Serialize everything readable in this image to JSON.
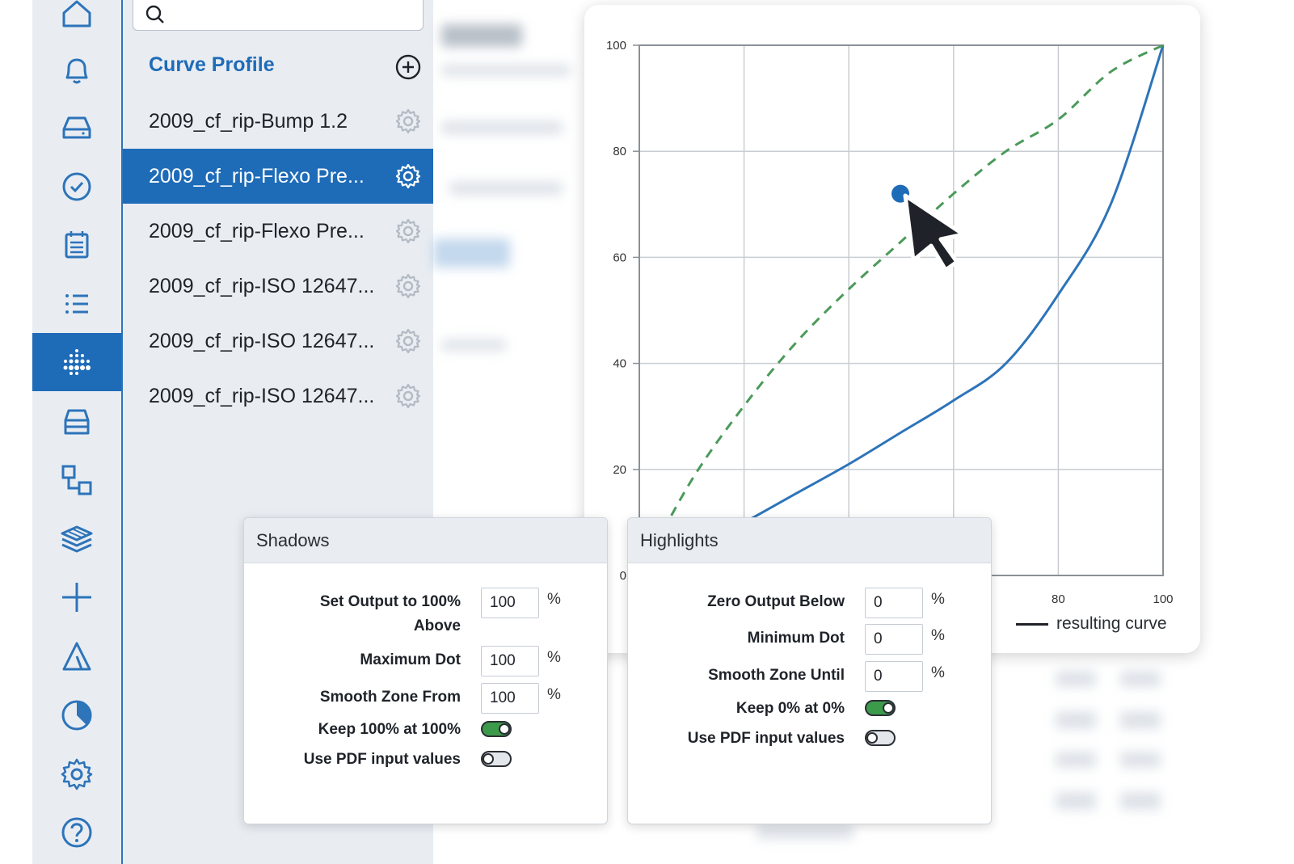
{
  "search": {
    "placeholder": ""
  },
  "panel": {
    "title": "Curve Profile",
    "profiles": [
      {
        "label": "2009_cf_rip-Bump 1.2",
        "selected": false
      },
      {
        "label": "2009_cf_rip-Flexo Pre...",
        "selected": true
      },
      {
        "label": "2009_cf_rip-Flexo Pre...",
        "selected": false
      },
      {
        "label": "2009_cf_rip-ISO 12647...",
        "selected": false
      },
      {
        "label": "2009_cf_rip-ISO 12647...",
        "selected": false
      },
      {
        "label": "2009_cf_rip-ISO 12647...",
        "selected": false
      }
    ]
  },
  "rail": {
    "icons": [
      "home-icon",
      "bell-icon",
      "drive-icon",
      "check-circle-icon",
      "calendar-icon",
      "list-icon",
      "dot-grid-icon",
      "tray-icon",
      "nodes-icon",
      "layers-icon",
      "crop-icon",
      "triangle-icon",
      "pie-icon",
      "gear-icon",
      "help-icon"
    ],
    "active_index": 6
  },
  "chart_data": {
    "type": "line",
    "x_ticks": [
      80,
      100
    ],
    "y_ticks": [
      0,
      20,
      40,
      60,
      80,
      100
    ],
    "xlim": [
      0,
      100
    ],
    "ylim": [
      0,
      100
    ],
    "grid": true,
    "legend": "bottom-right",
    "series": [
      {
        "name": "resulting curve",
        "style": "solid",
        "color": "#2d74b9",
        "x": [
          0,
          10,
          20,
          30,
          40,
          50,
          60,
          70,
          80,
          90,
          100
        ],
        "y": [
          0,
          5,
          10,
          15.5,
          21,
          27,
          33,
          40,
          53,
          70,
          100
        ]
      },
      {
        "name": "",
        "style": "dashed",
        "color": "#4b9a5a",
        "x": [
          0,
          10,
          20,
          30,
          40,
          50,
          60,
          70,
          80,
          90,
          100
        ],
        "y": [
          0,
          18,
          32,
          44,
          54,
          63,
          72,
          80,
          86,
          95,
          100
        ]
      }
    ],
    "control_point": {
      "x": 50,
      "y": 72,
      "color": "#1e6bb8"
    },
    "legend_label": "resulting curve"
  },
  "shadows": {
    "title": "Shadows",
    "set_output_label_1": "Set Output to 100%",
    "set_output_label_2": "Above",
    "set_output_value": "100",
    "max_dot_label": "Maximum Dot",
    "max_dot_value": "100",
    "smooth_from_label": "Smooth Zone From",
    "smooth_from_value": "100",
    "keep_label": "Keep 100% at 100%",
    "keep_on": true,
    "pdf_label": "Use PDF input values",
    "pdf_on": false,
    "unit": "%"
  },
  "highlights": {
    "title": "Highlights",
    "zero_output_label": "Zero Output Below",
    "zero_output_value": "0",
    "min_dot_label": "Minimum Dot",
    "min_dot_value": "0",
    "smooth_until_label": "Smooth Zone Until",
    "smooth_until_value": "0",
    "keep_label": "Keep 0% at 0%",
    "keep_on": true,
    "pdf_label": "Use PDF input values",
    "pdf_on": false,
    "unit": "%"
  }
}
